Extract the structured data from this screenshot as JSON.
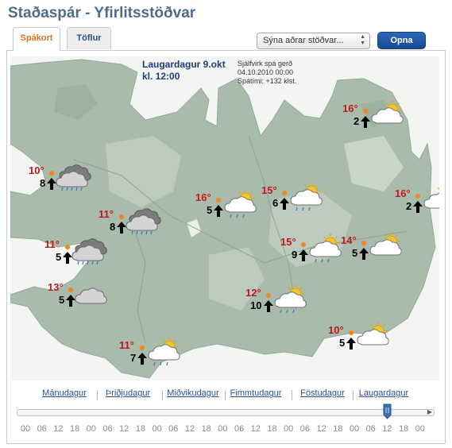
{
  "header": {
    "title": "Staðaspár - Yfirlitsstöðvar"
  },
  "tabs": [
    {
      "label": "Spákort",
      "active": true
    },
    {
      "label": "Töflur",
      "active": false
    }
  ],
  "station_select": {
    "value": "Sýna aðrar stöðvar..."
  },
  "open_button": {
    "label": "Opna"
  },
  "map": {
    "date_line1": "Laugardagur 9.okt",
    "date_line2": "kl. 12:00",
    "info_line1": "Sjálfvirk spá gerð",
    "info_line2": "04.10.2010 00:00",
    "info_line3": "Spátími: +132 klst."
  },
  "stations": [
    {
      "temp": "10°",
      "wind": "8",
      "icon": "rain-cloud-icon"
    },
    {
      "temp": "11°",
      "wind": "8",
      "icon": "rain-cloud-icon"
    },
    {
      "temp": "11°",
      "wind": "5",
      "icon": "rain-cloud-icon"
    },
    {
      "temp": "13°",
      "wind": "5",
      "icon": "cloud-icon"
    },
    {
      "temp": "11°",
      "wind": "7",
      "icon": "sun-cloud-rain-icon"
    },
    {
      "temp": "16°",
      "wind": "5",
      "icon": "sun-cloud-rain-icon"
    },
    {
      "temp": "15°",
      "wind": "6",
      "icon": "sun-cloud-rain-icon"
    },
    {
      "temp": "15°",
      "wind": "9",
      "icon": "sun-cloud-rain-icon"
    },
    {
      "temp": "12°",
      "wind": "10",
      "icon": "sun-cloud-rain-icon"
    },
    {
      "temp": "14°",
      "wind": "5",
      "icon": "sun-cloud-icon"
    },
    {
      "temp": "16°",
      "wind": "2",
      "icon": "sun-cloud-icon"
    },
    {
      "temp": "16°",
      "wind": "2",
      "icon": "sun-cloud-icon"
    },
    {
      "temp": "10°",
      "wind": "5",
      "icon": "sun-cloud-icon"
    }
  ],
  "timeline": {
    "days": [
      "Mánudagur",
      "Þriðjudagur",
      "Miðvikudagur",
      "Fimmtudagur",
      "Föstudagur",
      "Laugardagur"
    ],
    "hours": [
      "00",
      "06",
      "12",
      "18",
      "00",
      "06",
      "12",
      "18",
      "00",
      "06",
      "12",
      "18",
      "00",
      "06",
      "12",
      "18",
      "00",
      "06",
      "12",
      "18",
      "00",
      "06",
      "12",
      "18",
      "00"
    ],
    "selected_label": "Laugardagur 12"
  }
}
